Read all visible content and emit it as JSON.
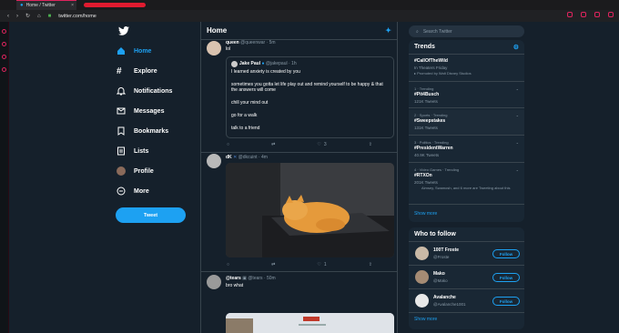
{
  "browser": {
    "tab_title": "Home / Twitter",
    "tab_close": "×",
    "url": "twitter.com/home"
  },
  "nav": {
    "items": [
      {
        "label": "Home",
        "icon": "home-icon"
      },
      {
        "label": "Explore",
        "icon": "hashtag-icon"
      },
      {
        "label": "Notifications",
        "icon": "bell-icon"
      },
      {
        "label": "Messages",
        "icon": "envelope-icon"
      },
      {
        "label": "Bookmarks",
        "icon": "bookmark-icon"
      },
      {
        "label": "Lists",
        "icon": "list-icon"
      },
      {
        "label": "Profile",
        "icon": "avatar"
      },
      {
        "label": "More",
        "icon": "more-circle-icon"
      }
    ],
    "tweet_button": "Tweet"
  },
  "timeline": {
    "title": "Home",
    "tweet1": {
      "name": "queen",
      "handle": "@queenwar · 5m",
      "text": "lol",
      "quote_name": "Jake Paul",
      "quote_handle": "@jakepaul · 1h",
      "quote_lines": [
        "I learned anxiety is created by you",
        "sometimes you gotta let life play out and remind yourself to be happy & that the answers will come",
        "chill your mind out",
        "go for a walk",
        "talk to a friend"
      ],
      "likes": "3"
    },
    "tweet2": {
      "name": "dK",
      "handle": "@dkcuint · 4m",
      "likes": "1"
    },
    "tweet3": {
      "name": "@tears",
      "handle": "@tears · 50m",
      "text": "bro what"
    }
  },
  "right": {
    "search_placeholder": "Search Twitter",
    "trends_title": "Trends",
    "trends": [
      {
        "meta": "",
        "name": "#CallOfTheWild",
        "count": "In Theaters Friday",
        "extra": "Promoted by Walt Disney Studios"
      },
      {
        "meta": "1 · Trending",
        "name": "#Pit4Busch",
        "count": "121K Tweets"
      },
      {
        "meta": "2 · Sports · Trending",
        "name": "#Sweepstakes",
        "count": "131K Tweets"
      },
      {
        "meta": "3 · Politics · Trending",
        "name": "#PresidentWarren",
        "count": "40.9K Tweets"
      },
      {
        "meta": "4 · Video Games · Trending",
        "name": "#RTXOn",
        "count": "201K Tweets",
        "extra": "Aimsey, Swamosh, and 6 more are Tweeting about this"
      }
    ],
    "trends_show_more": "Show more",
    "wtf_title": "Who to follow",
    "follow": [
      {
        "name": "100T Froste",
        "handle": "@Froste",
        "button": "Follow"
      },
      {
        "name": "Mako",
        "handle": "@Mako",
        "button": "Follow"
      },
      {
        "name": "Avalanche",
        "handle": "@Avalanche1001",
        "button": "Follow"
      }
    ],
    "wtf_show_more": "Show more"
  },
  "colors": {
    "accent": "#1da1f2",
    "bg": "#15202b",
    "panel": "#192734",
    "border": "#38444d",
    "chrome_accent": "#e0245e"
  }
}
